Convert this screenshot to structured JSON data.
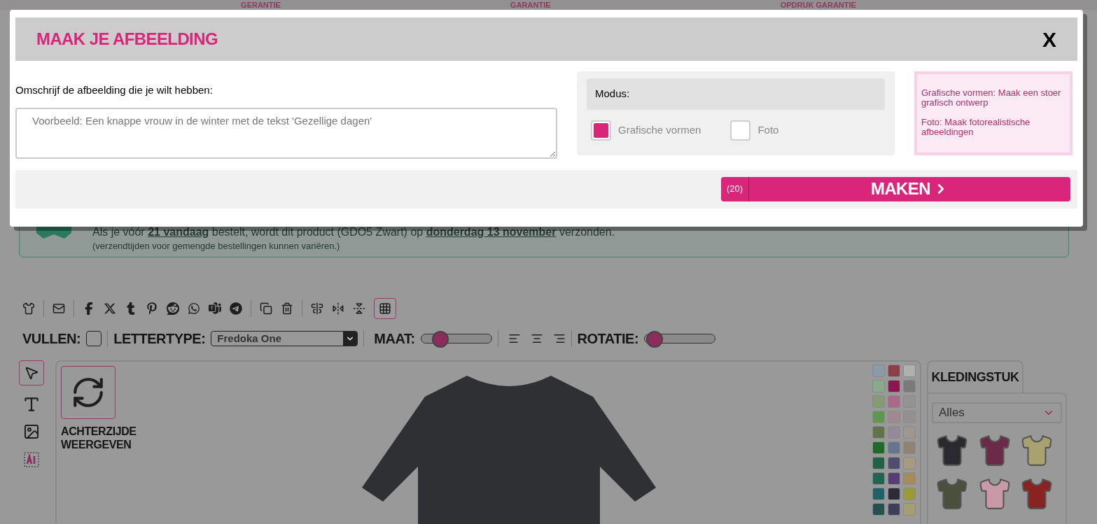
{
  "background_page": {
    "guarantees": [
      "GERANTIE",
      "GARANTIE",
      "OPDRUK GARANTIE"
    ],
    "shipping_notice": {
      "text": "Als je vóór **21 vandaag** bestelt, wordt dit product (GDO5 Zwart) op **donderdag 13 november** verzonden.",
      "note": "(verzendtijden voor gemengde bestellingen kunnen variëren.)"
    },
    "options_bar": {
      "fill_label": "VULLEN:",
      "fill_checked": false,
      "font_label": "LETTERTYPE:",
      "font_value": "Fredoka One",
      "size_slider": {
        "label": "MAAT:",
        "level": 0.2
      },
      "rotation_slider": {
        "label": "ROTATIE:",
        "level": 0.02
      }
    },
    "back_side_label": "ACHTERZIJDE WEERGEVEN",
    "swatches": [
      {
        "color": "#8a9aa6"
      },
      {
        "color": "#8e3e4a"
      },
      {
        "color": "#b0b0b0"
      },
      {
        "color": "#8aa98e"
      },
      {
        "color": "#8c1650"
      },
      {
        "color": "#7a7a7a"
      },
      {
        "color": "#869a74"
      },
      {
        "color": "#a86a88"
      },
      {
        "color": "#939393"
      },
      {
        "color": "#5f9650"
      },
      {
        "color": "#a08a92"
      },
      {
        "color": "#968f90"
      },
      {
        "color": "#627347"
      },
      {
        "color": "#958899"
      },
      {
        "color": "#9c9890"
      },
      {
        "color": "#1f6a28"
      },
      {
        "color": "#66748f"
      },
      {
        "color": "#8f8272"
      },
      {
        "color": "#1f6244"
      },
      {
        "color": "#4f4c6f"
      },
      {
        "color": "#a89a80"
      },
      {
        "color": "#1f6650"
      },
      {
        "color": "#563d74"
      },
      {
        "color": "#a58a5c"
      },
      {
        "color": "#1e6168"
      },
      {
        "color": "#2e2a38"
      },
      {
        "color": "#9a9a38"
      },
      {
        "color": "#22514f"
      },
      {
        "color": "#3c3f57"
      },
      {
        "color": "#a39f70"
      }
    ],
    "garment_panel": {
      "tab": "KLEDINGSTUK",
      "category": "Alles",
      "products": [
        {
          "color": "#2a2a2e"
        },
        {
          "color": "#6b2b48"
        },
        {
          "color": "#a8a270"
        },
        {
          "color": "#4a4f3e"
        },
        {
          "color": "#c89aa8"
        },
        {
          "color": "#8a2222"
        }
      ]
    }
  },
  "dialog": {
    "title": "MAAK JE AFBEELDING",
    "close": "X",
    "prompt_label": "Omschrijf de afbeelding die je wilt hebben:",
    "prompt_placeholder": "Voorbeeld: Een knappe vrouw in de winter met de tekst 'Gezellige dagen'",
    "mode_label": "Modus:",
    "modes": [
      {
        "label": "Grafische vormen",
        "selected": true
      },
      {
        "label": "Foto",
        "selected": false
      }
    ],
    "info": [
      "Grafische vormen: Maak een stoer grafisch ontwerp",
      "Foto: Maak fotorealistische afbeeldingen"
    ],
    "credits": "(20)",
    "make_button": "MAKEN"
  }
}
